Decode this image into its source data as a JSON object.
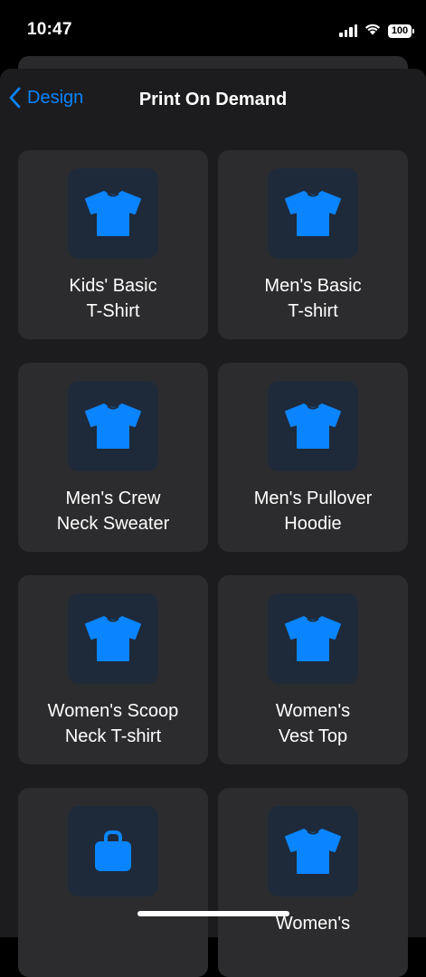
{
  "status_bar": {
    "time": "10:47",
    "battery": "100",
    "icons": [
      "cellular-signal-icon",
      "wifi-icon",
      "battery-icon"
    ]
  },
  "nav": {
    "back_label": "Design",
    "title": "Print On Demand"
  },
  "colors": {
    "accent": "#0a84ff",
    "background": "#1c1c1e",
    "card": "#2c2c2e",
    "icon_tile": "#1e2a3a"
  },
  "products": [
    {
      "label": "Kids' Basic\nT-Shirt",
      "icon": "tshirt-icon"
    },
    {
      "label": "Men's Basic\nT-shirt",
      "icon": "tshirt-icon"
    },
    {
      "label": "Men's Crew\nNeck Sweater",
      "icon": "tshirt-icon"
    },
    {
      "label": "Men's Pullover\nHoodie",
      "icon": "tshirt-icon"
    },
    {
      "label": "Women's Scoop\nNeck T-shirt",
      "icon": "tshirt-icon"
    },
    {
      "label": "Women's\nVest Top",
      "icon": "tshirt-icon"
    },
    {
      "label": "",
      "icon": "bag-icon"
    },
    {
      "label": "Women's",
      "icon": "tshirt-icon"
    }
  ]
}
